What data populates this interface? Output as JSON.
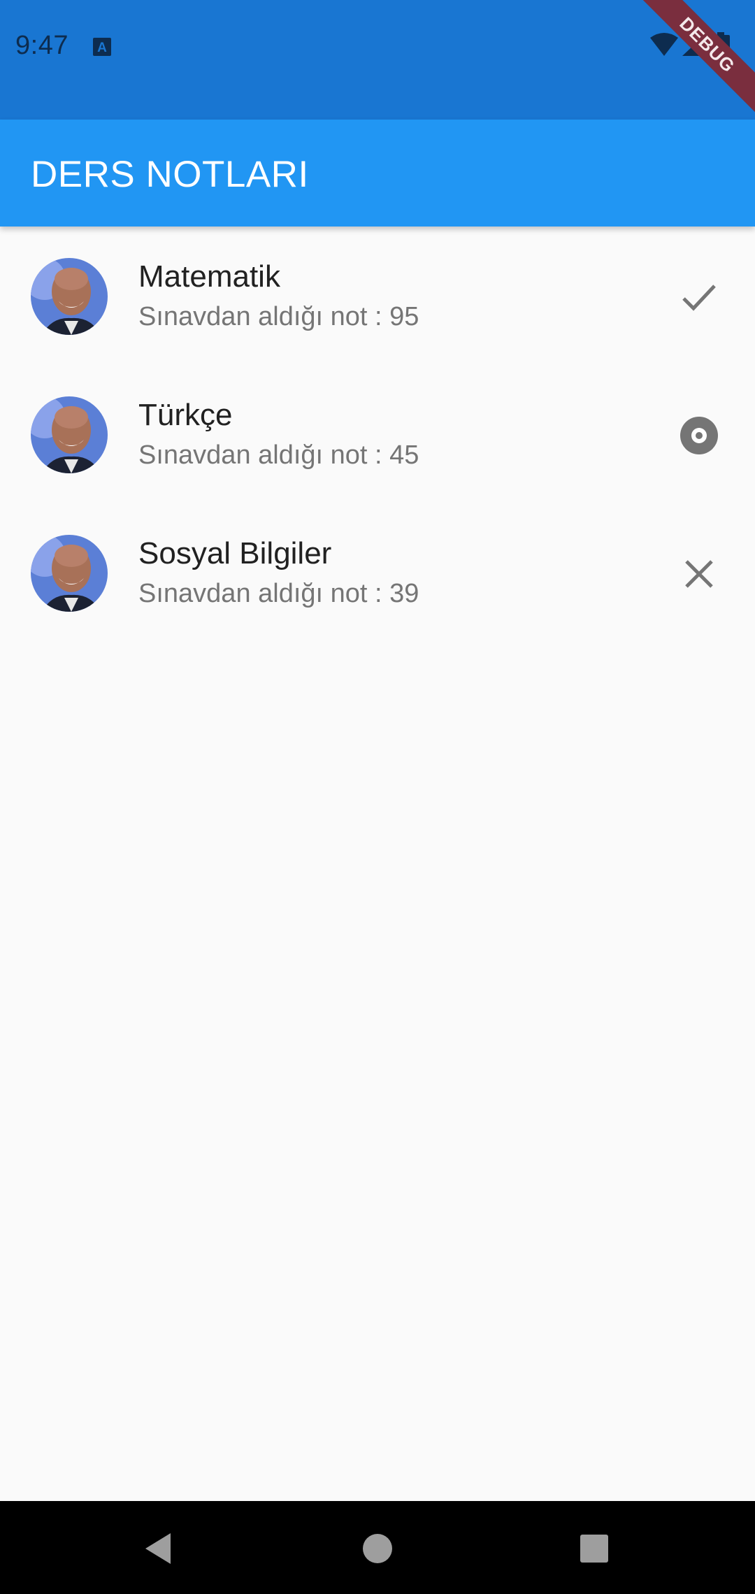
{
  "status_bar": {
    "time": "9:47",
    "icons": [
      "text-a-icon",
      "wifi-icon",
      "signal-icon",
      "battery-icon"
    ]
  },
  "debug_banner": {
    "label": "DEBUG"
  },
  "app_bar": {
    "title": "DERS NOTLARI"
  },
  "list": {
    "items": [
      {
        "title": "Matematik",
        "subtitle": "Sınavdan aldığı not : 95",
        "trailing_icon": "check-icon"
      },
      {
        "title": "Türkçe",
        "subtitle": "Sınavdan aldığı not : 45",
        "trailing_icon": "radio-circle-icon"
      },
      {
        "title": "Sosyal Bilgiler",
        "subtitle": "Sınavdan aldığı not : 39",
        "trailing_icon": "close-icon"
      }
    ]
  },
  "nav_bar": {
    "buttons": [
      "back-icon",
      "home-icon",
      "recents-icon"
    ]
  },
  "colors": {
    "status_bar": "#1976d2",
    "app_bar": "#2196f3",
    "background": "#fafafa",
    "icon_gray": "#757575"
  }
}
